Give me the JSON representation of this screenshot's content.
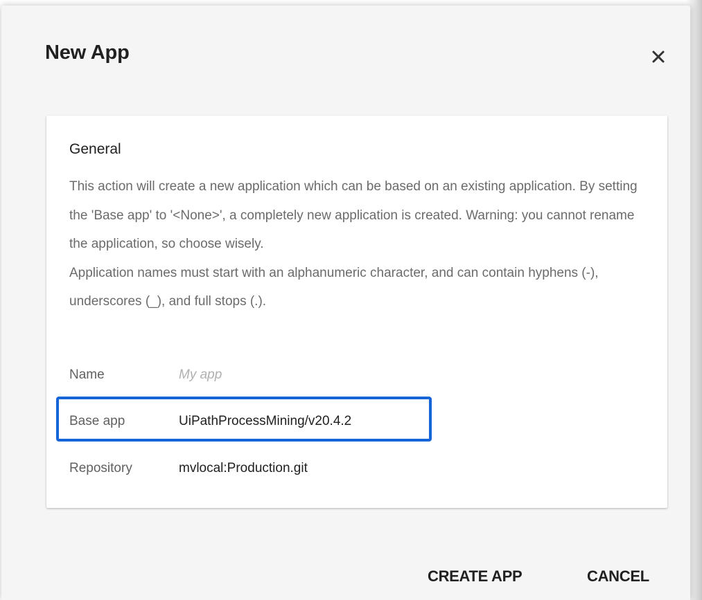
{
  "dialog": {
    "title": "New App",
    "close_icon": "close-icon"
  },
  "general": {
    "heading": "General",
    "paragraph1": "This action will create a new application which can be based on an existing application. By setting the 'Base app' to '<None>', a completely new application is created. Warning: you cannot rename the application, so choose wisely.",
    "paragraph2": "Application names must start with an alphanumeric character, and can contain hyphens (-), underscores (_), and full stops (.)."
  },
  "fields": {
    "name": {
      "label": "Name",
      "value": "",
      "placeholder": "My app"
    },
    "base_app": {
      "label": "Base app",
      "value": "UiPathProcessMining/v20.4.2"
    },
    "repository": {
      "label": "Repository",
      "value": "mvlocal:Production.git"
    }
  },
  "actions": {
    "create_label": "CREATE APP",
    "cancel_label": "CANCEL"
  },
  "colors": {
    "highlight": "#1565d8",
    "dialog_background": "#f5f5f5",
    "card_background": "#ffffff"
  }
}
